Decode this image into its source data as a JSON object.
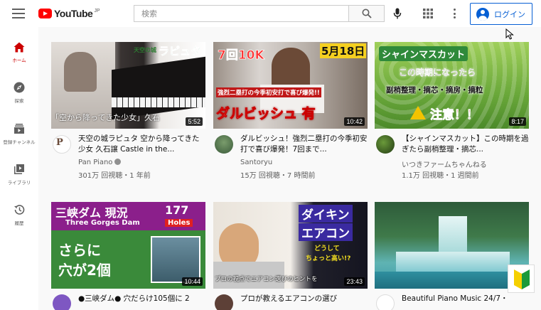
{
  "header": {
    "logo_text": "YouTube",
    "logo_region": "JP",
    "search_placeholder": "検索",
    "login_label": "ログイン",
    "icons": [
      "menu-icon",
      "search-icon",
      "mic-icon",
      "apps-icon",
      "more-vert-icon",
      "account-icon"
    ]
  },
  "sidebar": {
    "items": [
      {
        "label": "ホーム",
        "icon": "home-icon",
        "active": true
      },
      {
        "label": "探索",
        "icon": "explore-icon"
      },
      {
        "label": "登録チャンネル",
        "icon": "subscriptions-icon"
      },
      {
        "label": "ライブラリ",
        "icon": "library-icon"
      },
      {
        "label": "履歴",
        "icon": "history-icon"
      }
    ]
  },
  "videos": [
    {
      "title": "天空の城ラピュタ 空から降ってきた少女 久石譲 Castle in the...",
      "channel": "Pan Piano",
      "verified": true,
      "meta": "301万 回視聴・1 年前",
      "duration": "5:52",
      "thumb_text": [
        "天空の城",
        "ラピュタ",
        "「空から降ってきた少女」久石"
      ]
    },
    {
      "title": "ダルビッシュ！強烈二塁打の今季初安打で喜び爆発！7回まで...",
      "channel": "Santoryu",
      "meta": "15万 回視聴・7 時間前",
      "duration": "10:42",
      "thumb_text": [
        "7回10K",
        "5月18日",
        "強烈二塁打の今季初安打で喜び爆発!!",
        "ダルビッシュ 有"
      ]
    },
    {
      "title": "【シャインマスカット】この時期を過ぎたら副梢整理・摘芯...",
      "channel": "いつきファームちゃんねる",
      "meta": "1.1万 回視聴・1 週間前",
      "duration": "8:17",
      "thumb_text": [
        "シャインマスカット",
        "この時期になったら",
        "副梢整理・摘芯・摘房・摘粒",
        "注意！！"
      ]
    },
    {
      "title": "●三峡ダム● 穴だらけ105個に 2",
      "duration": "10:44",
      "thumb_text": [
        "三峡ダム 現況",
        "177",
        "Three Gorges Dam",
        "Holes",
        "さらに",
        "穴が2個"
      ]
    },
    {
      "title": "プロが教えるエアコンの選び",
      "duration": "23:43",
      "thumb_text": [
        "ダイキン",
        "エアコン",
        "どうして",
        "ちょっと高い!?",
        "プロの視点でエアコン選びのヒントを"
      ]
    },
    {
      "title": "Beautiful Piano Music 24/7・",
      "thumb_text": []
    }
  ],
  "colors": {
    "accent_blue": "#065fd4",
    "brand_red": "#ff0000",
    "active_red": "#cc0000"
  }
}
